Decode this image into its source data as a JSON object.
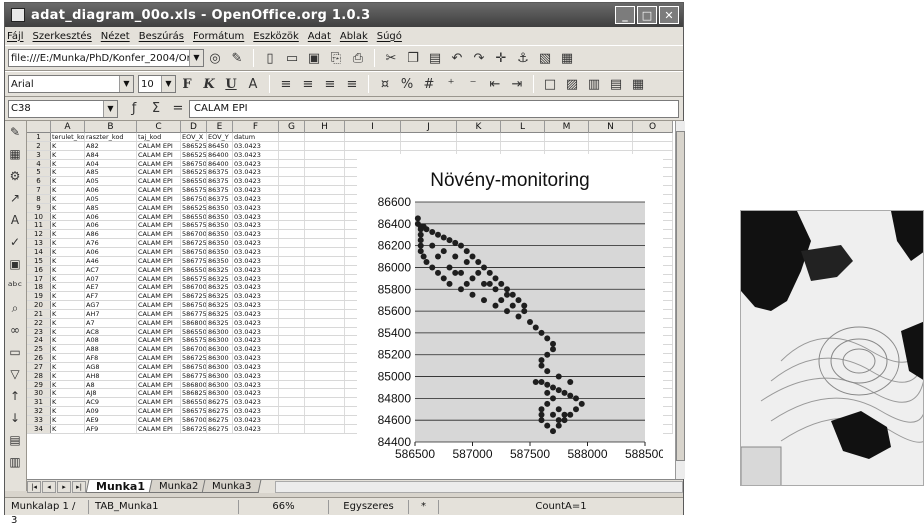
{
  "window": {
    "title": "adat_diagram_00o.xls - OpenOffice.org 1.0.3",
    "controls": {
      "minimize": "_",
      "maximize": "□",
      "close": "✕"
    }
  },
  "menubar": [
    "Fájl",
    "Szerkesztés",
    "Nézet",
    "Beszúrás",
    "Formátum",
    "Eszközök",
    "Adat",
    "Ablak",
    "Súgó"
  ],
  "toolbar": {
    "path": "file:///E:/Munka/PhD/Konfer_2004/Orsz_T",
    "font": "Arial",
    "size": "10"
  },
  "formulabar": {
    "cell_ref": "C38",
    "sum_symbol": "Σ",
    "equals": "=",
    "value": "CALAM EPI"
  },
  "columns": [
    "A",
    "B",
    "C",
    "D",
    "E",
    "F",
    "G",
    "H",
    "I",
    "J",
    "K",
    "L",
    "M",
    "N",
    "O"
  ],
  "table": {
    "headers": [
      "terulet_kod",
      "raszter_kod",
      "taj_kod",
      "EOV_X",
      "EOV_Y",
      "datum"
    ],
    "rows": [
      [
        "K",
        "A82",
        "CALAM EPI",
        "586525",
        "86450",
        "03.0423"
      ],
      [
        "K",
        "A84",
        "CALAM EPI",
        "586525",
        "86400",
        "03.0423"
      ],
      [
        "K",
        "A04",
        "CALAM EPI",
        "586750",
        "86400",
        "03.0423"
      ],
      [
        "K",
        "A85",
        "CALAM EPI",
        "586525",
        "86375",
        "03.0423"
      ],
      [
        "K",
        "A05",
        "CALAM EPI",
        "586550",
        "86375",
        "03.0423"
      ],
      [
        "K",
        "A06",
        "CALAM EPI",
        "586575",
        "86375",
        "03.0423"
      ],
      [
        "K",
        "A05",
        "CALAM EPI",
        "586750",
        "86375",
        "03.0423"
      ],
      [
        "K",
        "A85",
        "CALAM EPI",
        "586525",
        "86350",
        "03.0423"
      ],
      [
        "K",
        "A06",
        "CALAM EPI",
        "586550",
        "86350",
        "03.0423"
      ],
      [
        "K",
        "A06",
        "CALAM EPI",
        "586575",
        "86350",
        "03.0423"
      ],
      [
        "K",
        "A86",
        "CALAM EPI",
        "586700",
        "86350",
        "03.0423"
      ],
      [
        "K",
        "A76",
        "CALAM EPI",
        "586725",
        "86350",
        "03.0423"
      ],
      [
        "K",
        "A06",
        "CALAM EPI",
        "586750",
        "86350",
        "03.0423"
      ],
      [
        "K",
        "A46",
        "CALAM EPI",
        "586775",
        "86350",
        "03.0423"
      ],
      [
        "K",
        "AC7",
        "CALAM EPI",
        "586550",
        "86325",
        "03.0423"
      ],
      [
        "K",
        "A07",
        "CALAM EPI",
        "586575",
        "86325",
        "03.0423"
      ],
      [
        "K",
        "AE7",
        "CALAM EPI",
        "586700",
        "86325",
        "03.0423"
      ],
      [
        "K",
        "AF7",
        "CALAM EPI",
        "586725",
        "86325",
        "03.0423"
      ],
      [
        "K",
        "AG7",
        "CALAM EPI",
        "586750",
        "86325",
        "03.0423"
      ],
      [
        "K",
        "AH7",
        "CALAM EPI",
        "586775",
        "86325",
        "03.0423"
      ],
      [
        "K",
        "A7",
        "CALAM EPI",
        "586800",
        "86325",
        "03.0423"
      ],
      [
        "K",
        "AC8",
        "CALAM EPI",
        "586550",
        "86300",
        "03.0423"
      ],
      [
        "K",
        "A08",
        "CALAM EPI",
        "586575",
        "86300",
        "03.0423"
      ],
      [
        "K",
        "A88",
        "CALAM EPI",
        "586700",
        "86300",
        "03.0423"
      ],
      [
        "K",
        "AF8",
        "CALAM EPI",
        "586725",
        "86300",
        "03.0423"
      ],
      [
        "K",
        "AG8",
        "CALAM EPI",
        "586750",
        "86300",
        "03.0423"
      ],
      [
        "K",
        "AH8",
        "CALAM EPI",
        "586775",
        "86300",
        "03.0423"
      ],
      [
        "K",
        "A8",
        "CALAM EPI",
        "586800",
        "86300",
        "03.0423"
      ],
      [
        "K",
        "AJ8",
        "CALAM EPI",
        "586825",
        "86300",
        "03.0423"
      ],
      [
        "K",
        "AC9",
        "CALAM EPI",
        "586550",
        "86275",
        "03.0423"
      ],
      [
        "K",
        "A09",
        "CALAM EPI",
        "586575",
        "86275",
        "03.0423"
      ],
      [
        "K",
        "AE9",
        "CALAM EPI",
        "586700",
        "86275",
        "03.0423"
      ],
      [
        "K",
        "AF9",
        "CALAM EPI",
        "586725",
        "86275",
        "03.0423"
      ]
    ]
  },
  "sheet_tabs": [
    "Munka1",
    "Munka2",
    "Munka3"
  ],
  "statusbar": {
    "sheet": "Munkalap 1 / 3",
    "tab": "TAB_Munka1",
    "zoom": "66%",
    "mode": "Egyszeres",
    "marker": "*",
    "count": "CountA=1"
  },
  "chart_data": {
    "type": "scatter",
    "title": "Növény-monitoring",
    "xlim": [
      586500,
      588500
    ],
    "ylim": [
      84400,
      86600
    ],
    "x_ticks": [
      "586500",
      "587000",
      "587500",
      "588000",
      "588500"
    ],
    "y_ticks": [
      "86600",
      "86400",
      "86200",
      "86000",
      "85800",
      "85600",
      "85400",
      "85200",
      "85000",
      "84800",
      "84600",
      "84400"
    ],
    "grid": "horizontal",
    "regions": [
      {
        "name": "main",
        "points": [
          [
            586525,
            86450
          ],
          [
            586525,
            86400
          ],
          [
            586550,
            86375
          ],
          [
            586575,
            86375
          ],
          [
            586600,
            86350
          ],
          [
            586650,
            86325
          ],
          [
            586700,
            86300
          ],
          [
            586750,
            86275
          ],
          [
            586800,
            86250
          ],
          [
            586850,
            86225
          ],
          [
            586900,
            86200
          ],
          [
            586950,
            86150
          ],
          [
            587000,
            86100
          ],
          [
            587050,
            86050
          ],
          [
            587100,
            86000
          ],
          [
            587150,
            85950
          ],
          [
            587200,
            85900
          ],
          [
            587250,
            85850
          ],
          [
            587300,
            85800
          ],
          [
            587350,
            85750
          ],
          [
            587400,
            85700
          ],
          [
            587450,
            85650
          ],
          [
            587450,
            85600
          ],
          [
            587400,
            85550
          ],
          [
            587300,
            85600
          ],
          [
            587200,
            85650
          ],
          [
            587100,
            85700
          ],
          [
            587000,
            85750
          ],
          [
            586900,
            85800
          ],
          [
            586800,
            85850
          ],
          [
            586750,
            85900
          ],
          [
            586700,
            85950
          ],
          [
            586650,
            86000
          ],
          [
            586600,
            86050
          ],
          [
            586575,
            86100
          ],
          [
            586550,
            86150
          ],
          [
            586550,
            86200
          ],
          [
            586550,
            86250
          ],
          [
            586550,
            86300
          ],
          [
            586550,
            86350
          ],
          [
            586700,
            86100
          ],
          [
            586800,
            86000
          ],
          [
            586900,
            85950
          ],
          [
            587000,
            85900
          ],
          [
            587100,
            85850
          ],
          [
            587200,
            85800
          ],
          [
            587300,
            85750
          ],
          [
            586850,
            86100
          ],
          [
            586950,
            86050
          ],
          [
            587050,
            85950
          ],
          [
            587150,
            85850
          ],
          [
            587250,
            85700
          ],
          [
            587350,
            85650
          ],
          [
            586650,
            86200
          ],
          [
            586750,
            86150
          ],
          [
            586850,
            85950
          ],
          [
            586950,
            85850
          ]
        ]
      },
      {
        "name": "tail",
        "points": [
          [
            587500,
            85500
          ],
          [
            587550,
            85450
          ],
          [
            587600,
            85400
          ],
          [
            587650,
            85350
          ],
          [
            587700,
            85300
          ],
          [
            587700,
            85250
          ],
          [
            587650,
            85200
          ],
          [
            587600,
            85150
          ],
          [
            587600,
            85100
          ],
          [
            587650,
            85050
          ],
          [
            587750,
            85000
          ],
          [
            587850,
            84950
          ]
        ]
      },
      {
        "name": "south",
        "points": [
          [
            587550,
            84950
          ],
          [
            587600,
            84950
          ],
          [
            587650,
            84925
          ],
          [
            587700,
            84900
          ],
          [
            587750,
            84875
          ],
          [
            587800,
            84850
          ],
          [
            587850,
            84825
          ],
          [
            587900,
            84800
          ],
          [
            587950,
            84750
          ],
          [
            587900,
            84700
          ],
          [
            587850,
            84650
          ],
          [
            587800,
            84600
          ],
          [
            587750,
            84550
          ],
          [
            587700,
            84500
          ],
          [
            587650,
            84550
          ],
          [
            587600,
            84600
          ],
          [
            587600,
            84650
          ],
          [
            587600,
            84700
          ],
          [
            587650,
            84750
          ],
          [
            587700,
            84800
          ],
          [
            587750,
            84700
          ],
          [
            587800,
            84650
          ],
          [
            587700,
            84650
          ],
          [
            587650,
            84850
          ],
          [
            587750,
            84600
          ]
        ]
      }
    ]
  },
  "map": {
    "type": "topographic-map-image"
  }
}
